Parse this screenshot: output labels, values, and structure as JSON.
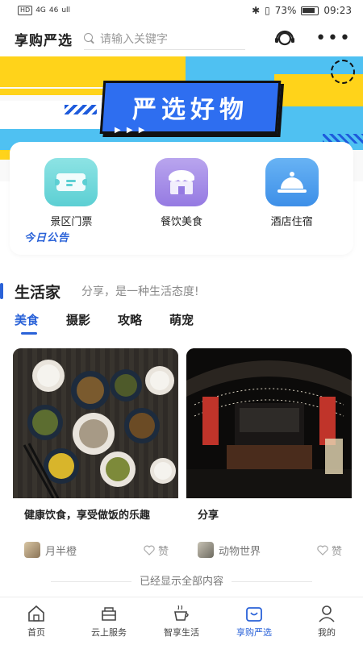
{
  "status_bar": {
    "left_indicators": [
      "HD",
      "4G",
      "46",
      "ull"
    ],
    "battery": "73%",
    "time": "09:23"
  },
  "header": {
    "title": "享购严选",
    "search_placeholder": "请输入关键字"
  },
  "banner": {
    "headline": "严选好物",
    "arrows": "▶ ▶ ▶"
  },
  "quick_menu": [
    {
      "label": "景区门票",
      "icon": "ticket-icon",
      "color": "#6fd7da"
    },
    {
      "label": "餐饮美食",
      "icon": "store-icon",
      "color": "#a98ee8"
    },
    {
      "label": "酒店住宿",
      "icon": "cloche-icon",
      "color": "#4a9ff0"
    }
  ],
  "notice_label": "今日公告",
  "section": {
    "title": "生活家",
    "subtitle": "分享，是一种生活态度!"
  },
  "tabs": [
    "美食",
    "摄影",
    "攻略",
    "萌宠"
  ],
  "cards": [
    {
      "title": "健康饮食，享受做饭的乐趣",
      "author": "月半橙",
      "like_label": "赞"
    },
    {
      "title": "分享",
      "author": "动物世界",
      "like_label": "赞"
    }
  ],
  "end_text": "已经显示全部内容",
  "bottom_nav": [
    {
      "label": "首页",
      "icon": "home-icon",
      "active": false
    },
    {
      "label": "云上服务",
      "icon": "cloud-service-icon",
      "active": false
    },
    {
      "label": "智享生活",
      "icon": "cup-icon",
      "active": false
    },
    {
      "label": "享购严选",
      "icon": "shopping-bag-icon",
      "active": true
    },
    {
      "label": "我的",
      "icon": "profile-icon",
      "active": false
    }
  ],
  "colors": {
    "accent": "#2a62d8",
    "banner_yellow": "#ffd31a",
    "banner_blue": "#2e6ef0",
    "banner_cyan": "#4fc1f2"
  }
}
